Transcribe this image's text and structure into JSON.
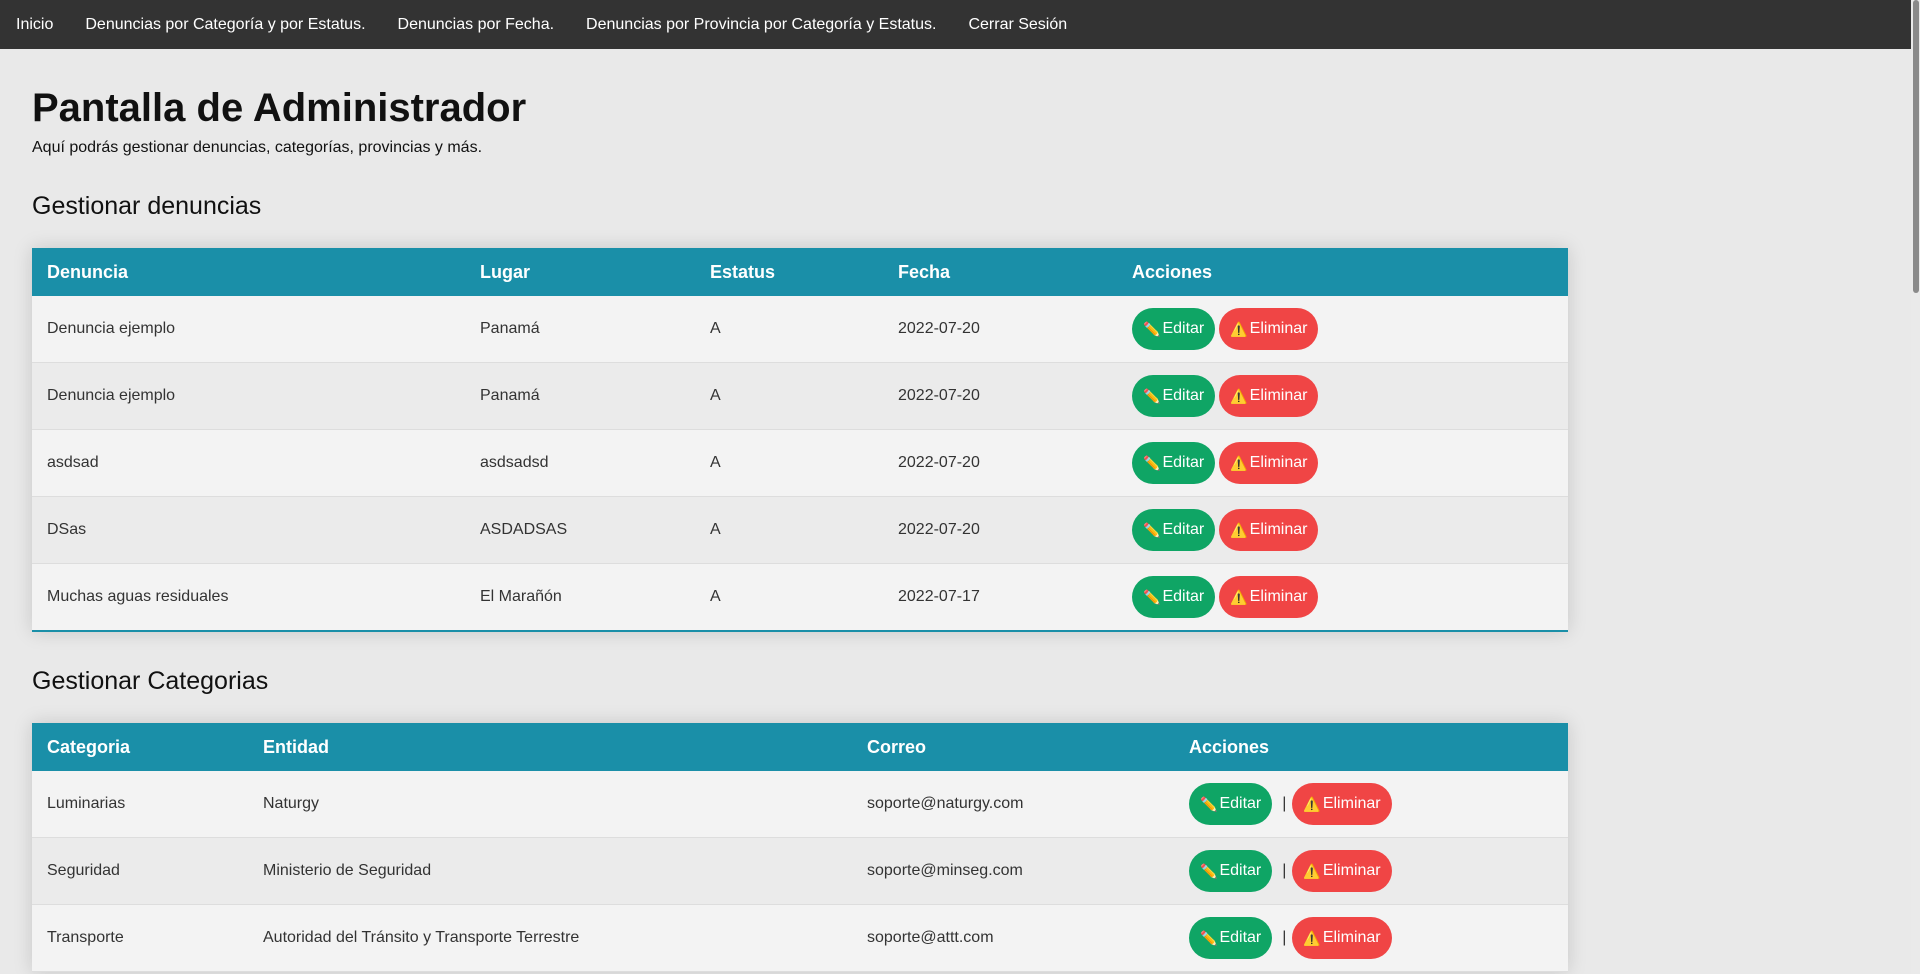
{
  "nav": {
    "items": [
      "Inicio",
      "Denuncias por Categoría y por Estatus.",
      "Denuncias por Fecha.",
      "Denuncias por Provincia por Categoría y Estatus.",
      "Cerrar Sesión"
    ]
  },
  "page": {
    "title": "Pantalla de Administrador",
    "subtitle": "Aquí podrás gestionar denuncias, categorías, provincias y más."
  },
  "denuncias": {
    "section_title": "Gestionar denuncias",
    "headers": [
      "Denuncia",
      "Lugar",
      "Estatus",
      "Fecha",
      "Acciones"
    ],
    "rows": [
      {
        "denuncia": "Denuncia ejemplo",
        "lugar": "Panamá",
        "estatus": "A",
        "fecha": "2022-07-20"
      },
      {
        "denuncia": "Denuncia ejemplo",
        "lugar": "Panamá",
        "estatus": "A",
        "fecha": "2022-07-20"
      },
      {
        "denuncia": "asdsad",
        "lugar": "asdsadsd",
        "estatus": "A",
        "fecha": "2022-07-20"
      },
      {
        "denuncia": "DSas",
        "lugar": "ASDADSAS",
        "estatus": "A",
        "fecha": "2022-07-20"
      },
      {
        "denuncia": "Muchas aguas residuales",
        "lugar": "El Marañón",
        "estatus": "A",
        "fecha": "2022-07-17"
      }
    ]
  },
  "categorias": {
    "section_title": "Gestionar Categorias",
    "headers": [
      "Categoria",
      "Entidad",
      "Correo",
      "Acciones"
    ],
    "rows": [
      {
        "categoria": "Luminarias",
        "entidad": "Naturgy",
        "correo": "soporte@naturgy.com"
      },
      {
        "categoria": "Seguridad",
        "entidad": "Ministerio de Seguridad",
        "correo": "soporte@minseg.com"
      },
      {
        "categoria": "Transporte",
        "entidad": "Autoridad del Tránsito y Transporte Terrestre",
        "correo": "soporte@attt.com"
      }
    ],
    "separator": "|"
  },
  "actions": {
    "edit_label": "Editar",
    "delete_label": "Eliminar",
    "edit_icon": "pencil-icon",
    "delete_icon": "warning-icon"
  },
  "colors": {
    "navbar": "#333333",
    "table_header": "#1a8fa8",
    "edit_button": "#0fa565",
    "delete_button": "#f04545"
  }
}
